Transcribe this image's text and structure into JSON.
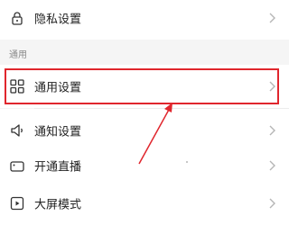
{
  "items": {
    "privacy": {
      "label": "隐私设置",
      "icon": "lock-icon"
    },
    "general": {
      "label": "通用设置",
      "icon": "grid-icon"
    },
    "notify": {
      "label": "通知设置",
      "icon": "speaker-icon"
    },
    "live": {
      "label": "开通直播",
      "icon": "camera-icon"
    },
    "bigscreen": {
      "label": "大屏模式",
      "icon": "play-icon"
    }
  },
  "section": {
    "title": "通用"
  },
  "colors": {
    "highlight": "#e0262d",
    "arrow": "#e0262d",
    "background": "#f5f5f5"
  }
}
